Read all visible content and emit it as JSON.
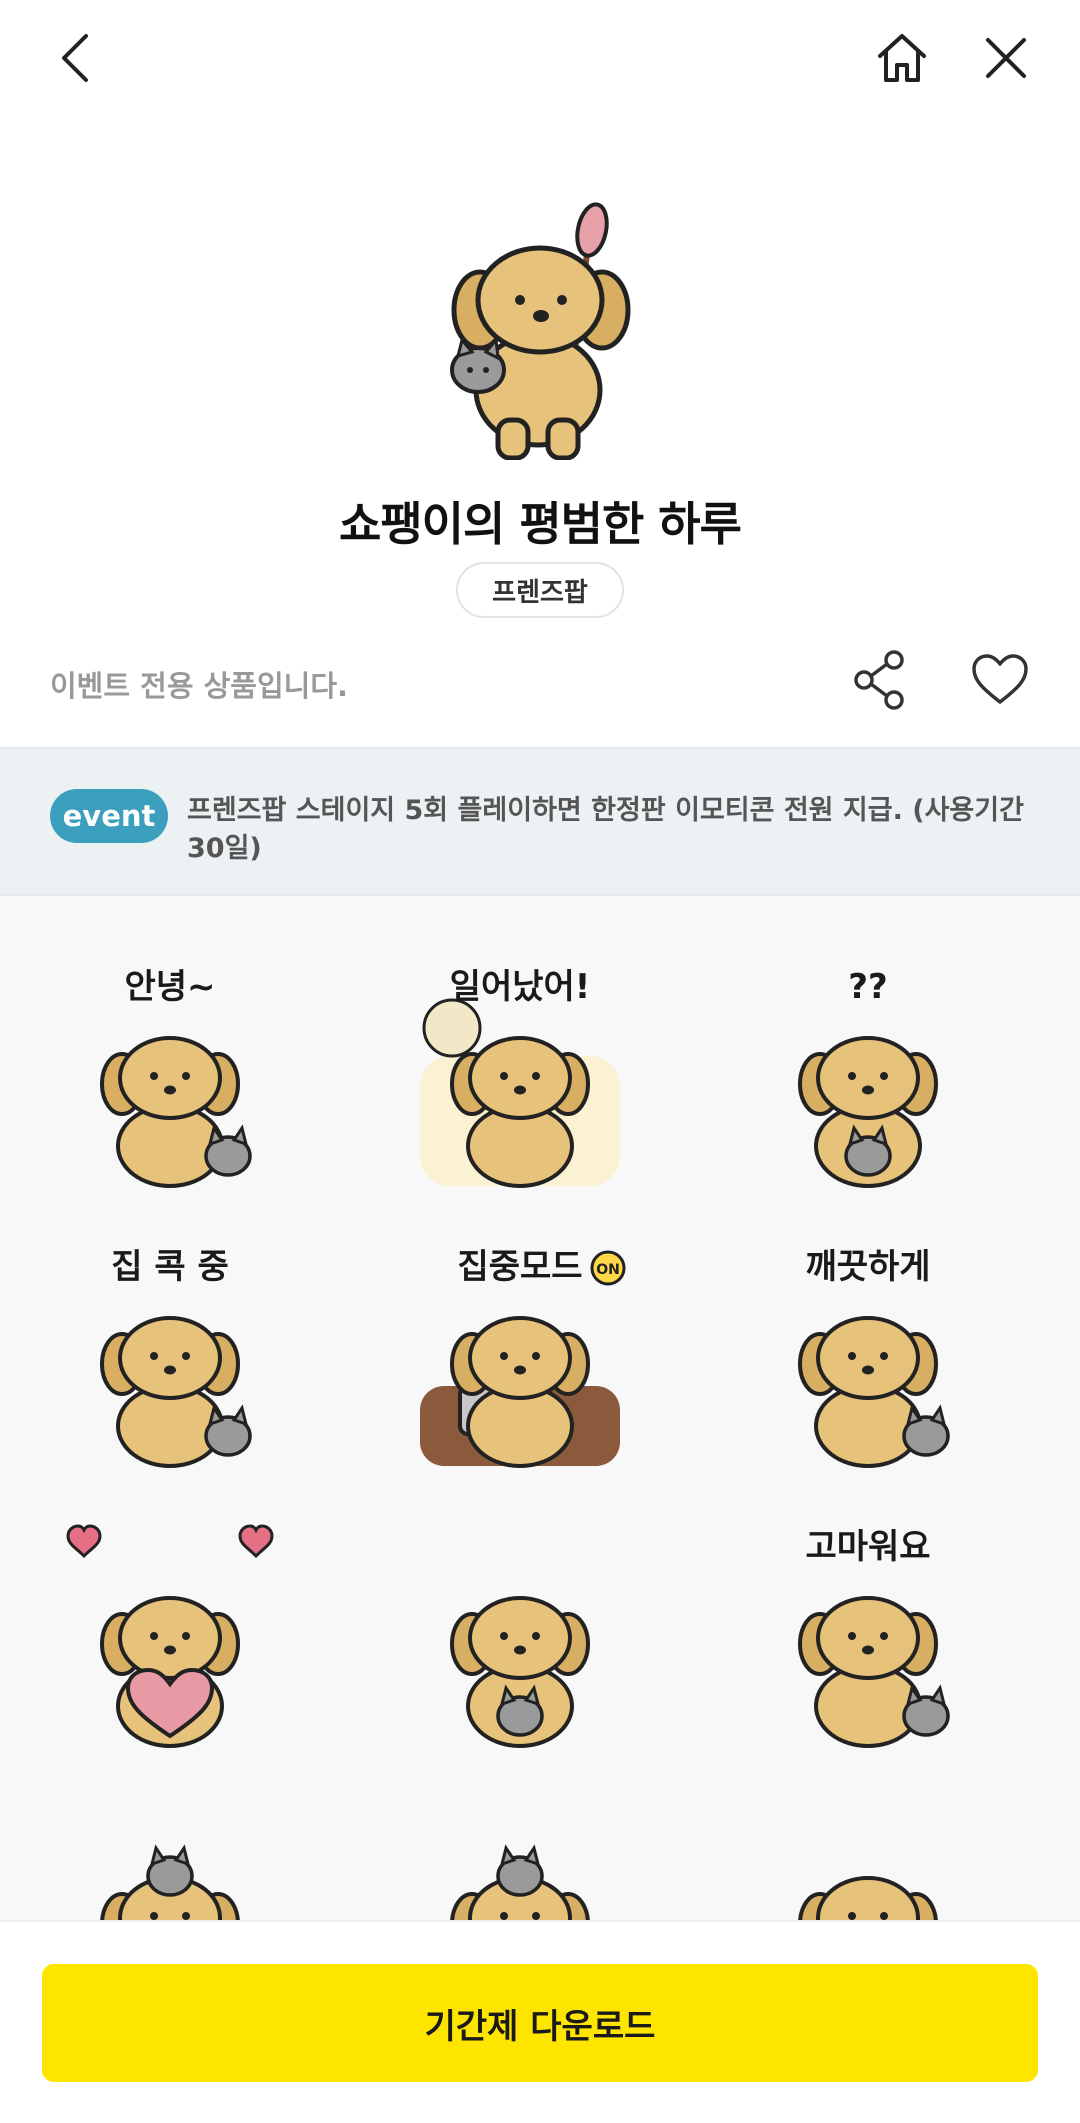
{
  "header": {
    "back_icon": "chevron-left-icon",
    "home_icon": "home-icon",
    "close_icon": "close-icon"
  },
  "product": {
    "title": "쇼팽이의 평범한 하루",
    "brand": "프렌즈팝",
    "notice": "이벤트 전용 상품입니다."
  },
  "actions": {
    "share_icon": "share-icon",
    "like_icon": "heart-icon"
  },
  "event": {
    "badge": "event",
    "text": "프렌즈팝 스테이지 5회 플레이하면 한정판 이모티콘 전원 지급. (사용기간 30일)"
  },
  "stickers": [
    {
      "caption": "안녕~"
    },
    {
      "caption": "일어났어!"
    },
    {
      "caption": "??"
    },
    {
      "caption": "집 콕 중"
    },
    {
      "caption": "집중모드"
    },
    {
      "caption": "깨끗하게"
    },
    {
      "caption": ""
    },
    {
      "caption": ""
    },
    {
      "caption": "고마워요"
    },
    {
      "caption": ""
    },
    {
      "caption": ""
    },
    {
      "caption": ""
    }
  ],
  "sticker_badge": "ON",
  "footer": {
    "download_label": "기간제 다운로드"
  },
  "colors": {
    "accent_yellow": "#fee500",
    "event_blue": "#3b9fbd",
    "dog_fur": "#e6c27a",
    "cat_fur": "#9a9a9a"
  }
}
